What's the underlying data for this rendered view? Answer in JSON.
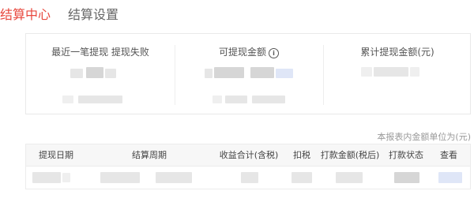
{
  "tabs": [
    {
      "label": "结算中心",
      "active": true
    },
    {
      "label": "结算设置",
      "active": false
    }
  ],
  "summary": {
    "col1_title": "最近一笔提现 提现失败",
    "col2_title": "可提现金额",
    "col2_icon": "info-icon",
    "col3_title": "累计提现金额(元)"
  },
  "table": {
    "unit_note": "本报表内金额单位为(元)",
    "headers": {
      "withdraw_date": "提现日期",
      "settlement_period": "结算周期",
      "income_total": "收益合计(含税)",
      "tax": "扣税",
      "payment_after_tax": "打款金额(税后)",
      "payment_status": "打款状态",
      "view": "查看"
    }
  },
  "colors": {
    "accent": "#e8483e",
    "inactive_tab": "#666666",
    "muted_text": "#999999"
  }
}
